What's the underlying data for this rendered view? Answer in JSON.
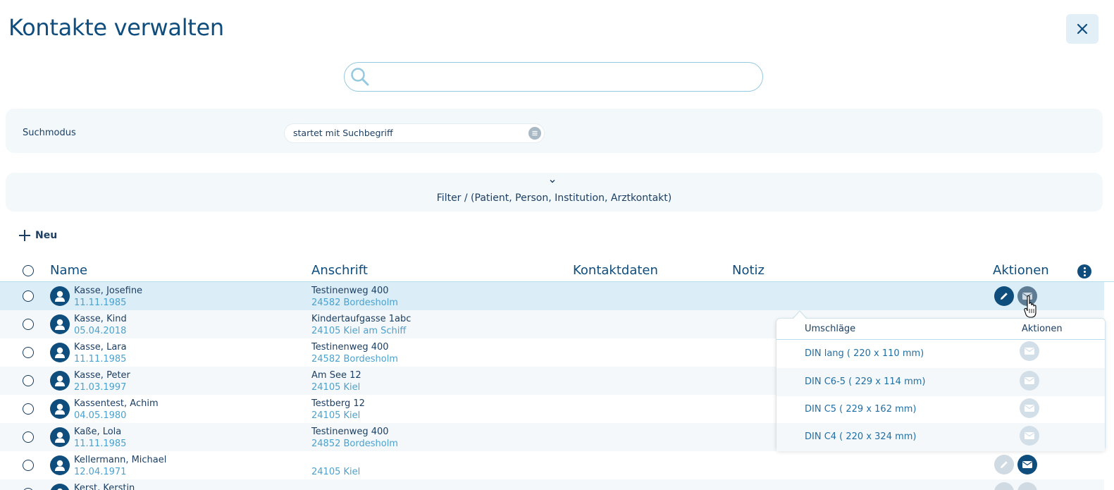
{
  "page": {
    "title": "Kontakte verwalten"
  },
  "search": {
    "placeholder": "",
    "value": ""
  },
  "search_mode": {
    "label": "Suchmodus",
    "selected": "startet mit Suchbegriff"
  },
  "filter": {
    "label": "Filter / (Patient, Person, Institution, Arztkontakt)"
  },
  "toolbar": {
    "new_label": "Neu"
  },
  "table": {
    "headers": {
      "name": "Name",
      "address": "Anschrift",
      "contact": "Kontaktdaten",
      "note": "Notiz",
      "actions": "Aktionen"
    },
    "rows": [
      {
        "name": "Kasse, Josefine",
        "birthdate": "11.11.1985",
        "street": "Testinenweg 400",
        "city": "24582 Bordesholm"
      },
      {
        "name": "Kasse, Kind",
        "birthdate": "05.04.2018",
        "street": "Kindertaufgasse 1abc",
        "city": "24105 Kiel am Schiff"
      },
      {
        "name": "Kasse, Lara",
        "birthdate": "11.11.1985",
        "street": "Testinenweg 400",
        "city": "24582 Bordesholm"
      },
      {
        "name": "Kasse, Peter",
        "birthdate": "21.03.1997",
        "street": "Am See 12",
        "city": "24105 Kiel"
      },
      {
        "name": "Kassentest, Achim",
        "birthdate": "04.05.1980",
        "street": "Testberg 12",
        "city": "24105 Kiel"
      },
      {
        "name": "Kaße, Lola",
        "birthdate": "11.11.1985",
        "street": "Testinenweg 400",
        "city": "24852 Bordesholm"
      },
      {
        "name": "Kellermann, Michael",
        "birthdate": "12.04.1971",
        "street": "",
        "city": "24105 Kiel"
      },
      {
        "name": "Kerst, Kerstin",
        "birthdate": "",
        "street": "",
        "city": ""
      }
    ]
  },
  "envelope_popup": {
    "headers": {
      "envelopes": "Umschläge",
      "actions": "Aktionen"
    },
    "items": [
      {
        "label": "DIN lang ( 220 x 110 mm)"
      },
      {
        "label": "DIN C6-5 ( 229 x 114 mm)"
      },
      {
        "label": "DIN C5 ( 229 x 162 mm)"
      },
      {
        "label": "DIN C4 ( 220 x 324 mm)"
      }
    ]
  },
  "icons": [
    "close-icon",
    "search-icon",
    "menu-icon",
    "chevron-down-icon",
    "plus-icon",
    "more-vertical-icon",
    "user-icon",
    "edit-icon",
    "envelope-icon",
    "hand-cursor-icon"
  ],
  "colors": {
    "primary": "#0f4d7d",
    "accent": "#4aa2cf",
    "panel": "#f3f8fb",
    "selected_row": "#dbedf6"
  }
}
